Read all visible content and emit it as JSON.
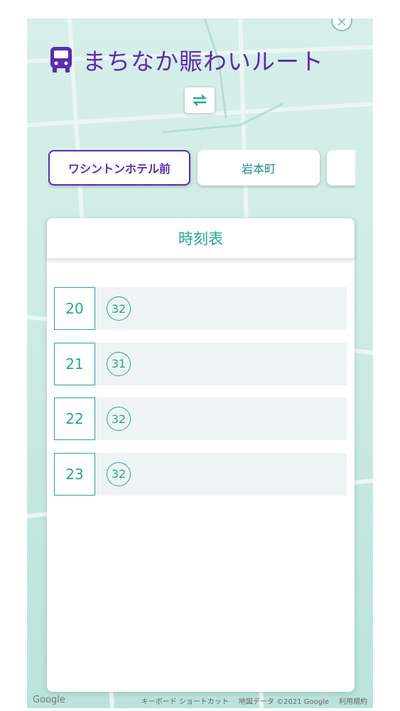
{
  "title": "まちなか賑わいルート",
  "icons": {
    "bus": "bus-icon",
    "swap": "swap-icon",
    "close": "close-icon"
  },
  "colors": {
    "accent": "#5a2bb5",
    "teal": "#26a69a"
  },
  "stops": [
    {
      "label": "ワシントンホテル前",
      "active": true
    },
    {
      "label": "岩本町",
      "active": false
    },
    {
      "label": "",
      "active": false
    }
  ],
  "timetable": {
    "title": "時刻表",
    "rows": [
      {
        "hour": "20",
        "minutes": [
          "32"
        ]
      },
      {
        "hour": "21",
        "minutes": [
          "31"
        ]
      },
      {
        "hour": "22",
        "minutes": [
          "32"
        ]
      },
      {
        "hour": "23",
        "minutes": [
          "32"
        ]
      }
    ]
  },
  "map_footer": {
    "shortcuts": "キーボード ショートカット",
    "data": "地図データ ©2021 Google",
    "terms": "利用規約"
  }
}
